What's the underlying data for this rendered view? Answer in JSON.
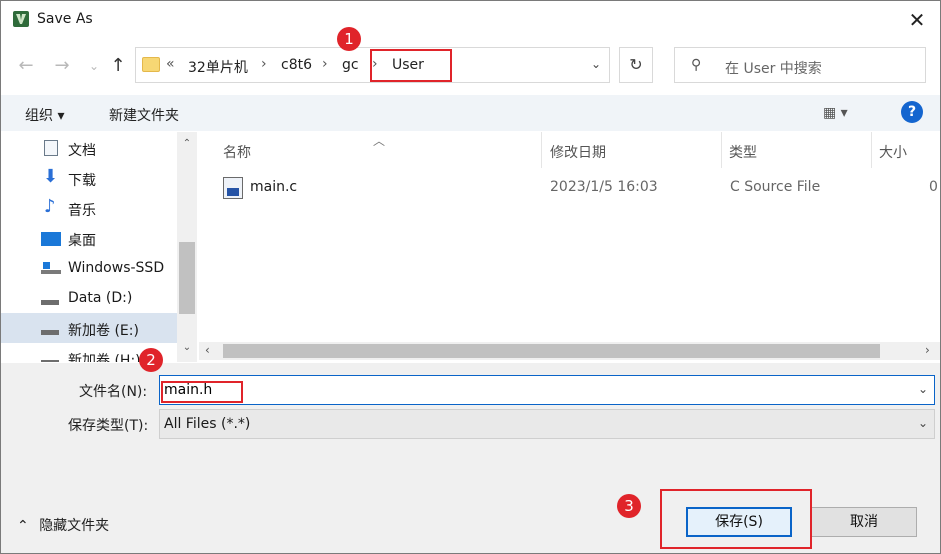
{
  "window": {
    "title": "Save As",
    "close_glyph": "✕"
  },
  "nav": {
    "back_glyph": "←",
    "forward_glyph": "→",
    "recent_glyph": "⌄",
    "up_glyph": "↑",
    "overflow": "«",
    "breadcrumbs": [
      "32单片机",
      "c8t6",
      "gc",
      "User"
    ],
    "refresh_glyph": "↻",
    "dropdown_glyph": "⌄",
    "search_placeholder": "在 User 中搜索"
  },
  "toolbar": {
    "organize_label": "组织 ▾",
    "new_folder_label": "新建文件夹",
    "view_glyph": "▦ ▾",
    "help_label": "?"
  },
  "sidebar": {
    "items": [
      {
        "label": "文档",
        "icon": "document-icon"
      },
      {
        "label": "下载",
        "icon": "download-icon"
      },
      {
        "label": "音乐",
        "icon": "music-icon"
      },
      {
        "label": "桌面",
        "icon": "desktop-icon"
      },
      {
        "label": "Windows-SSD",
        "icon": "drive-windows-icon"
      },
      {
        "label": "Data (D:)",
        "icon": "drive-icon"
      },
      {
        "label": "新加卷 (E:)",
        "icon": "drive-icon",
        "selected": true
      },
      {
        "label": "新加卷 (H:)",
        "icon": "drive-icon"
      }
    ]
  },
  "columns": {
    "name": "名称",
    "modified": "修改日期",
    "type": "类型",
    "size": "大小"
  },
  "files": [
    {
      "name": "main.c",
      "modified": "2023/1/5 16:03",
      "type": "C Source File",
      "size": "0"
    }
  ],
  "form": {
    "filename_label": "文件名(N):",
    "filename_value": "main.h",
    "filetype_label": "保存类型(T):",
    "filetype_value": "All Files (*.*)"
  },
  "footer": {
    "hide_folders_label": "隐藏文件夹",
    "save_label": "保存(S)",
    "cancel_label": "取消"
  },
  "annotations": {
    "color": "#e0242a",
    "badges": [
      "1",
      "2",
      "3"
    ]
  }
}
